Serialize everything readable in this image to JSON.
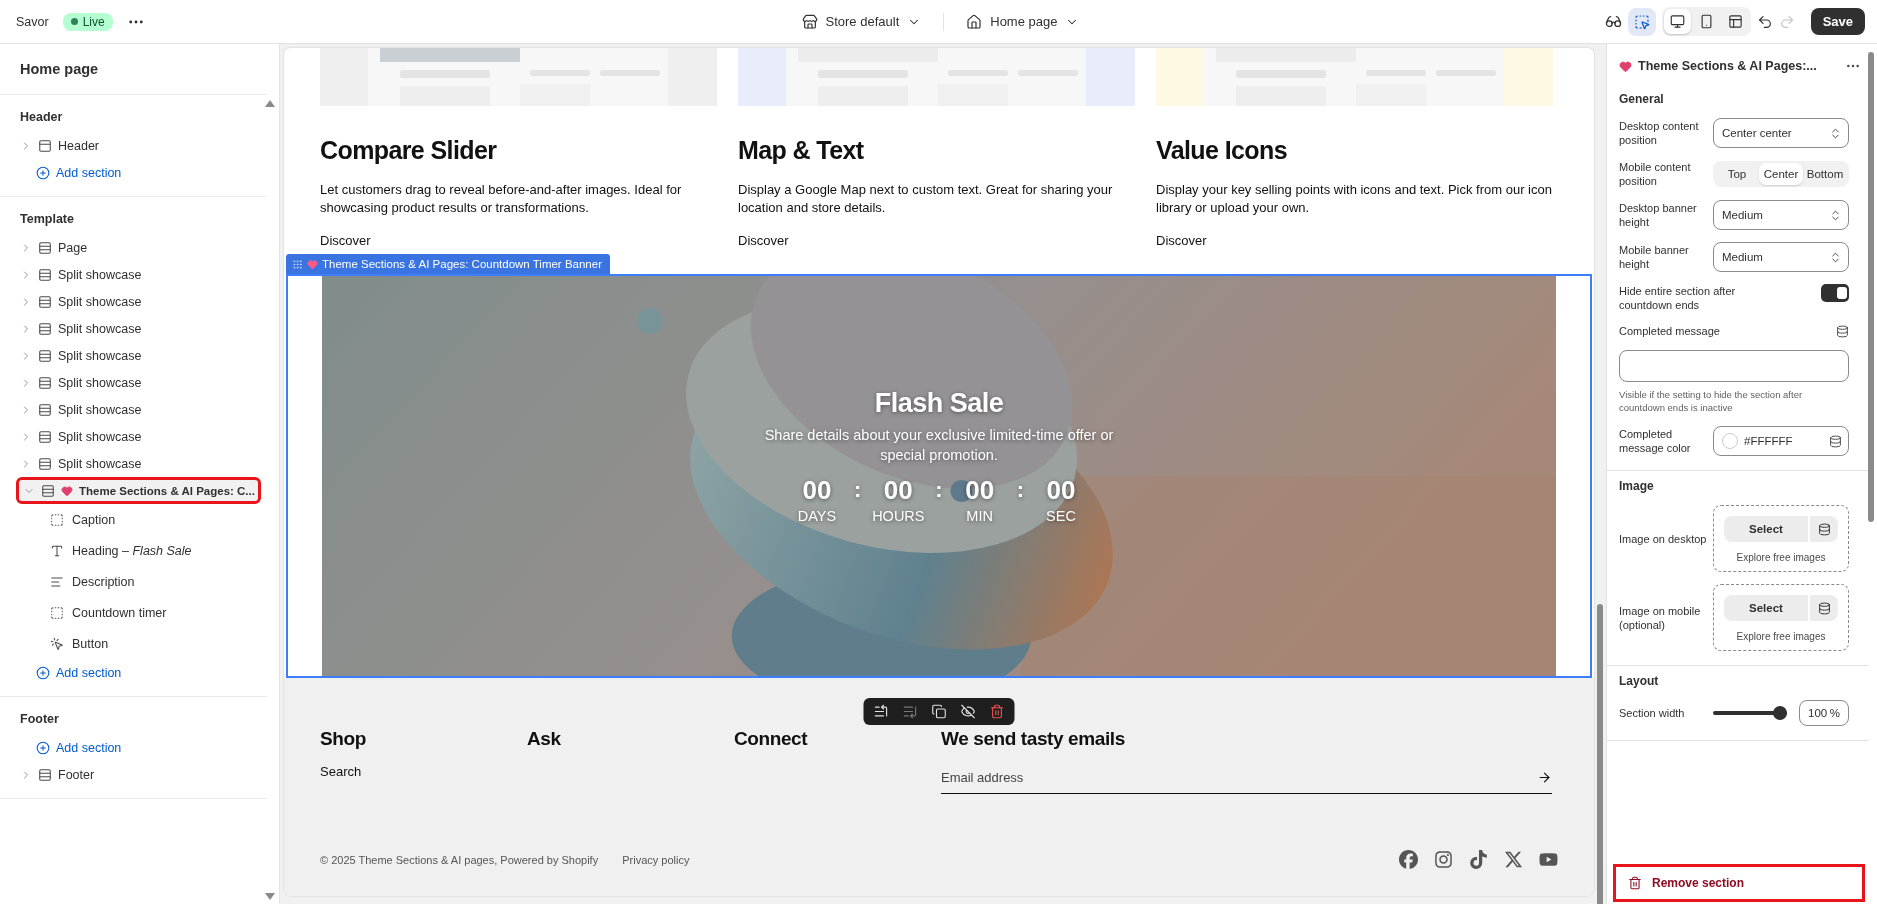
{
  "topbar": {
    "store_name": "Savor",
    "status": "Live",
    "theme_picker": "Store default",
    "page_picker": "Home page",
    "devices": [
      {
        "kind": "desktop",
        "selected": true
      },
      {
        "kind": "mobile",
        "selected": false
      },
      {
        "kind": "fullscreen",
        "selected": false
      }
    ],
    "save": "Save"
  },
  "sidebar": {
    "title": "Home page",
    "groups": [
      {
        "heading": "Header",
        "entries": [
          {
            "kind": "header",
            "label": "Header",
            "expanded": false,
            "selected": false
          },
          {
            "kind": "add",
            "label": "Add section"
          }
        ]
      },
      {
        "heading": "Template",
        "entries": [
          {
            "kind": "section",
            "label": "Page",
            "expanded": false,
            "selected": false
          },
          {
            "kind": "section",
            "label": "Split showcase",
            "expanded": false,
            "selected": false
          },
          {
            "kind": "section",
            "label": "Split showcase",
            "expanded": false,
            "selected": false
          },
          {
            "kind": "section",
            "label": "Split showcase",
            "expanded": false,
            "selected": false
          },
          {
            "kind": "section",
            "label": "Split showcase",
            "expanded": false,
            "selected": false
          },
          {
            "kind": "section",
            "label": "Split showcase",
            "expanded": false,
            "selected": false
          },
          {
            "kind": "section",
            "label": "Split showcase",
            "expanded": false,
            "selected": false
          },
          {
            "kind": "section",
            "label": "Split showcase",
            "expanded": false,
            "selected": false
          },
          {
            "kind": "section",
            "label": "Split showcase",
            "expanded": false,
            "selected": false
          },
          {
            "kind": "app-section",
            "label": "Theme Sections & AI Pages: C...",
            "expanded": true,
            "selected": true,
            "children": [
              {
                "kind": "caption",
                "label": "Caption",
                "selected": false
              },
              {
                "kind": "heading",
                "label": "Heading – *Flash Sale*",
                "selected": false
              },
              {
                "kind": "text",
                "label": "Description",
                "selected": false
              },
              {
                "kind": "caption",
                "label": "Countdown timer",
                "selected": false
              },
              {
                "kind": "button",
                "label": "Button",
                "selected": false
              }
            ]
          },
          {
            "kind": "add",
            "label": "Add section"
          }
        ]
      },
      {
        "heading": "Footer",
        "entries": [
          {
            "kind": "add",
            "label": "Add section"
          },
          {
            "kind": "section",
            "label": "Footer",
            "expanded": false,
            "selected": false
          }
        ]
      }
    ]
  },
  "preview": {
    "features": [
      {
        "title": "Compare Slider",
        "description": "Let customers drag to reveal before-and-after images. Ideal for showcasing product results or transformations.",
        "link": "Discover"
      },
      {
        "title": "Map & Text",
        "description": "Display a Google Map next to custom text. Great for sharing your location and store details.",
        "link": "Discover"
      },
      {
        "title": "Value Icons",
        "description": "Display your key selling points with icons and text. Pick from our icon library or upload your own.",
        "link": "Discover"
      }
    ],
    "section_tag": "Theme Sections & AI Pages: Countdown Timer Banner",
    "banner": {
      "heading": "Flash Sale",
      "text": "Share details about your exclusive limited-time offer or special promotion.",
      "countdown": [
        {
          "value": "00",
          "label": "DAYS"
        },
        {
          "value": "00",
          "label": "HOURS"
        },
        {
          "value": "00",
          "label": "MIN"
        },
        {
          "value": "00",
          "label": "SEC"
        }
      ],
      "separator": ":"
    },
    "footer": {
      "columns": [
        {
          "heading": "Shop",
          "links": [
            "Search"
          ]
        },
        {
          "heading": "Ask"
        },
        {
          "heading": "Connect"
        }
      ],
      "newsletter": {
        "heading": "We send tasty emails",
        "placeholder": "Email address"
      },
      "copyright": "© 2025 Theme Sections & AI pages, Powered by Shopify",
      "policy": "Privacy policy"
    }
  },
  "settings": {
    "title": "Theme Sections & AI Pages:...",
    "groups": [
      {
        "heading": "General",
        "fields": [
          {
            "kind": "select",
            "label": "Desktop content position",
            "value": "Center center"
          },
          {
            "kind": "segmented",
            "label": "Mobile content position",
            "options": [
              {
                "label": "Top",
                "selected": false
              },
              {
                "label": "Center",
                "selected": true
              },
              {
                "label": "Bottom",
                "selected": false
              }
            ]
          },
          {
            "kind": "select",
            "label": "Desktop banner height",
            "value": "Medium"
          },
          {
            "kind": "select",
            "label": "Mobile banner height",
            "value": "Medium"
          },
          {
            "kind": "toggle",
            "label": "Hide entire section after countdown ends",
            "on": true
          },
          {
            "kind": "text",
            "label": "Completed message",
            "help": "Visible if the setting to hide the section after countdown ends is inactive"
          },
          {
            "kind": "color",
            "label": "Completed message color",
            "value": "#FFFFFF"
          }
        ]
      },
      {
        "heading": "Image",
        "fields": [
          {
            "label": "Image on desktop",
            "button": "Select",
            "link": "Explore free images"
          },
          {
            "label": "Image on mobile (optional)",
            "button": "Select",
            "link": "Explore free images"
          }
        ]
      },
      {
        "heading": "Layout",
        "fields": [
          {
            "kind": "slider",
            "label": "Section width",
            "level": 1,
            "value": "100",
            "unit": "%"
          }
        ]
      }
    ],
    "remove": "Remove section"
  }
}
